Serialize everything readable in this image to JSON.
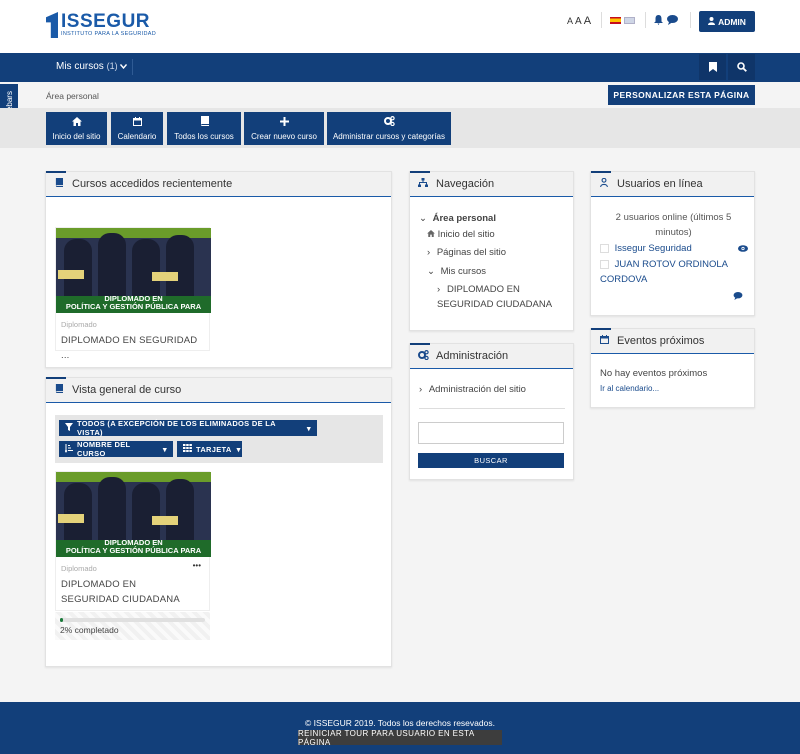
{
  "header": {
    "logo_name": "ISSEGUR",
    "logo_sub": "INSTITUTO PARA LA SEGURIDAD",
    "font_sizes": [
      "A",
      "A",
      "A"
    ],
    "admin_label": "ADMIN"
  },
  "navbar": {
    "my_courses": "Mis cursos",
    "my_courses_count": "(1)"
  },
  "sidebar_toggle": "Hide sidebars",
  "breadcrumb": "Área personal",
  "personalize_label": "PERSONALIZAR ESTA PÁGINA",
  "quick_buttons": [
    {
      "label": "Inicio del sitio",
      "icon": "home-icon"
    },
    {
      "label": "Calendario",
      "icon": "calendar-icon"
    },
    {
      "label": "Todos los cursos",
      "icon": "book-icon"
    },
    {
      "label": "Crear nuevo curso",
      "icon": "plus-icon"
    },
    {
      "label": "Administrar cursos y categorías",
      "icon": "cogs-icon"
    }
  ],
  "recent_courses": {
    "title": "Cursos accedidos recientemente",
    "course": {
      "category": "Diplomado",
      "name": "DIPLOMADO EN SEGURIDAD ...",
      "image_caption_1": "DIPLOMADO EN",
      "image_caption_2": "POLÍTICA Y GESTIÓN PÚBLICA PARA"
    }
  },
  "overview": {
    "title": "Vista general de curso",
    "filter_label": "TODOS (A EXCEPCIÓN DE LOS ELIMINADOS DE LA VISTA)",
    "sort_label": "NOMBRE DEL CURSO",
    "view_label": "TARJETA",
    "course": {
      "category": "Diplomado",
      "name_line1": "DIPLOMADO EN",
      "name_line2": "SEGURIDAD CIUDADANA",
      "menu": "•••",
      "progress_percent": 2,
      "progress_text": "2% completado",
      "image_caption_1": "DIPLOMADO EN",
      "image_caption_2": "POLÍTICA Y GESTIÓN PÚBLICA PARA"
    }
  },
  "navigation": {
    "title": "Navegación",
    "root": "Área personal",
    "home": "Inicio del sitio",
    "site_pages": "Páginas del sitio",
    "my_courses": "Mis cursos",
    "course_line1": "DIPLOMADO EN",
    "course_line2": "SEGURIDAD CIUDADANA"
  },
  "administration": {
    "title": "Administración",
    "site_admin": "Administración del sitio",
    "search_button": "BUSCAR"
  },
  "online_users": {
    "title": "Usuarios en línea",
    "summary_line1": "2 usuarios online (últimos 5",
    "summary_line2": "minutos)",
    "user1": "Issegur Seguridad",
    "user2_line1": "JUAN ROTOV ORDINOLA",
    "user2_line2": "CORDOVA"
  },
  "upcoming_events": {
    "title": "Eventos próximos",
    "empty_text": "No hay eventos próximos",
    "calendar_link": "Ir al calendario..."
  },
  "footer": {
    "copyright": "© ISSEGUR 2019. Todos los derechos resevados.",
    "tour_button": "REINICIAR TOUR PARA USUARIO EN ESTA PÁGINA"
  },
  "colors": {
    "primary": "#123f7a",
    "accent": "#1a5aa8",
    "progress": "#1a7a3a"
  }
}
